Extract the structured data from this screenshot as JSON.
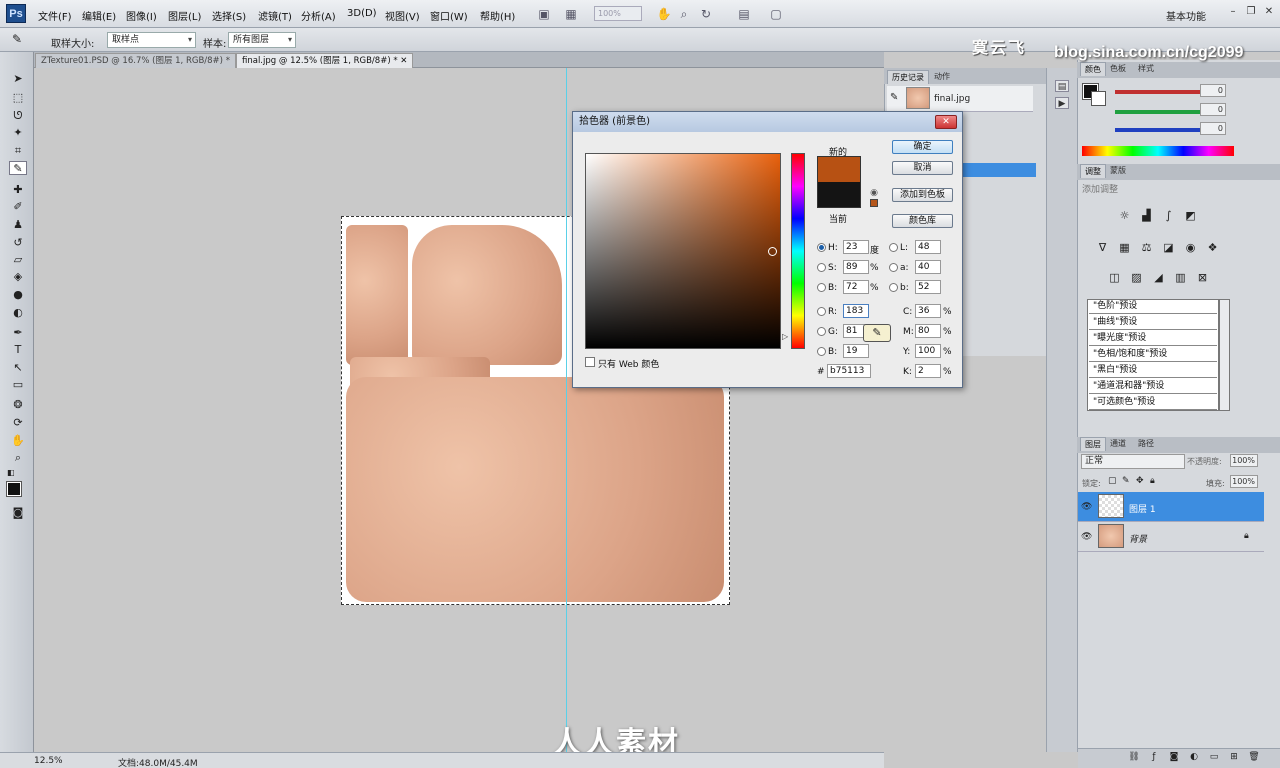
{
  "app": {
    "logo": "Ps",
    "workspace": "基本功能",
    "zoom_field": "100%"
  },
  "menu": [
    "文件(F)",
    "编辑(E)",
    "图像(I)",
    "图层(L)",
    "选择(S)",
    "滤镜(T)",
    "分析(A)",
    "3D(D)",
    "视图(V)",
    "窗口(W)",
    "帮助(H)"
  ],
  "options": {
    "sample_size_label": "取样大小:",
    "sample_size_value": "取样点",
    "sample_label": "样本:",
    "sample_value": "所有图层"
  },
  "watermark": {
    "title": "寞云飞",
    "blog": "blog.sina.com.cn/cg2099",
    "site": "人人素材"
  },
  "tabs": [
    {
      "label": "ZTexture01.PSD @ 16.7% (图层 1, RGB/8#) *"
    },
    {
      "label": "final.jpg @ 12.5% (图层 1, RGB/8#) *"
    }
  ],
  "status": {
    "zoom": "12.5%",
    "doc": "文档:48.0M/45.4M"
  },
  "picker": {
    "title": "拾色器 (前景色)",
    "new_label": "新的",
    "current_label": "当前",
    "ok": "确定",
    "cancel": "取消",
    "add_swatch": "添加到色板",
    "color_libraries": "颜色库",
    "web_only": "只有 Web 颜色",
    "new_color": "#b75113",
    "current_color": "#141414",
    "fields": {
      "H": {
        "label": "H:",
        "value": "23",
        "unit": "度"
      },
      "S": {
        "label": "S:",
        "value": "89",
        "unit": "%"
      },
      "Bv": {
        "label": "B:",
        "value": "72",
        "unit": "%"
      },
      "R": {
        "label": "R:",
        "value": "183"
      },
      "G": {
        "label": "G:",
        "value": "81"
      },
      "Bc": {
        "label": "B:",
        "value": "19"
      },
      "L": {
        "label": "L:",
        "value": "48"
      },
      "a": {
        "label": "a:",
        "value": "40"
      },
      "b": {
        "label": "b:",
        "value": "52"
      },
      "C": {
        "label": "C:",
        "value": "36",
        "unit": "%"
      },
      "M": {
        "label": "M:",
        "value": "80",
        "unit": "%"
      },
      "Y": {
        "label": "Y:",
        "value": "100",
        "unit": "%"
      },
      "K": {
        "label": "K:",
        "value": "2",
        "unit": "%"
      }
    },
    "hex_prefix": "#",
    "hex": "b75113"
  },
  "history": {
    "tabs": [
      "历史记录",
      "动作"
    ],
    "item": "final.jpg"
  },
  "color_panel": {
    "tabs": [
      "颜色",
      "色板",
      "样式"
    ],
    "R": "0",
    "G": "0",
    "B": "0",
    "rgb_colors": {
      "R": "#c03030",
      "G": "#20a040",
      "B": "#2040c0"
    }
  },
  "adjustments": {
    "tabs": [
      "调整",
      "蒙版"
    ],
    "title": "添加调整",
    "presets": [
      "\"色阶\"预设",
      "\"曲线\"预设",
      "\"曝光度\"预设",
      "\"色相/饱和度\"预设",
      "\"黑白\"预设",
      "\"通道混和器\"预设",
      "\"可选颜色\"预设"
    ]
  },
  "layers": {
    "tabs": [
      "图层",
      "通道",
      "路径"
    ],
    "blend": "正常",
    "opacity_label": "不透明度:",
    "opacity": "100%",
    "lock_label": "锁定:",
    "fill_label": "填充:",
    "fill": "100%",
    "items": [
      {
        "name": "图层 1",
        "selected": true
      },
      {
        "name": "背景",
        "selected": false
      }
    ]
  },
  "colors": {
    "accent": "#3d8de0",
    "guide": "#5ad0e8"
  }
}
